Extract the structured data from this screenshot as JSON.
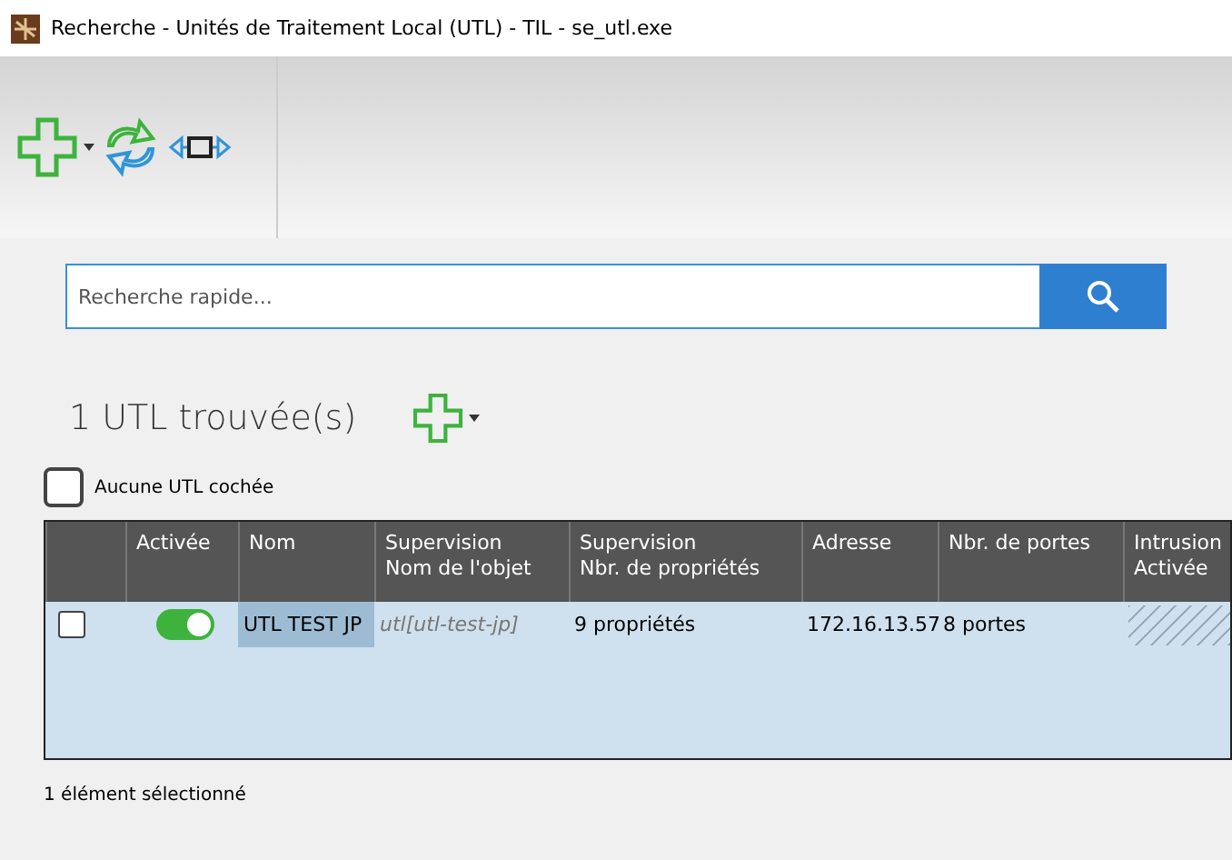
{
  "window": {
    "title": "Recherche - Unités de Traitement Local (UTL) - TIL - se_utl.exe"
  },
  "search": {
    "placeholder": "Recherche rapide..."
  },
  "result_count": "1 UTL trouvée(s)",
  "check_all": {
    "label": "Aucune UTL cochée",
    "checked": false
  },
  "table": {
    "columns": [
      "Activée",
      "Nom",
      "Supervision\nNom de l'objet",
      "Supervision\nNbr. de propriétés",
      "Adresse",
      "Nbr. de portes",
      "Intrusion\nActivée"
    ],
    "rows": [
      {
        "checked": false,
        "selected": true,
        "enabled": true,
        "name": "UTL TEST JP",
        "object": "utl[utl-test-jp]",
        "properties": "9 propriétés",
        "address": "172.16.13.57",
        "ports": "8 portes",
        "intrusion_available": false
      }
    ]
  },
  "status_bar": "1 élément sélectionné"
}
